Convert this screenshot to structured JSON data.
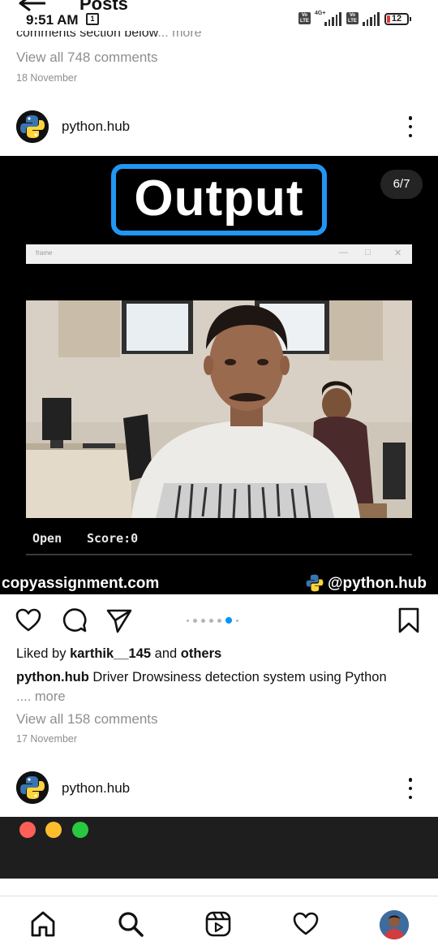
{
  "status_bar": {
    "time": "9:51 AM",
    "calendar_day": "1",
    "network_label": "4G+",
    "sim1": "Vo LTE",
    "sim2": "Vo LTE",
    "battery": "12"
  },
  "header": {
    "title": "Posts"
  },
  "previous_post": {
    "caption_tail": "comments section below",
    "more": "... more",
    "view_comments": "View all 748 comments",
    "date": "18 November"
  },
  "post": {
    "username": "python.hub",
    "media": {
      "heading": "Output",
      "counter": "6/7",
      "window_title": "frame",
      "status_open": "Open",
      "status_score": "Score:0",
      "watermark_left": "copyassignment.com",
      "watermark_right": "@python.hub"
    },
    "carousel": {
      "total": 7,
      "current": 6
    },
    "likes": {
      "prefix": "Liked by",
      "user": "karthik__145",
      "joiner": "and",
      "others": "others"
    },
    "caption": {
      "author": "python.hub",
      "text": "Driver Drowsiness detection system using Python",
      "more": ".... more"
    },
    "view_comments": "View all 158 comments",
    "date": "17 November"
  },
  "next_post": {
    "username": "python.hub",
    "window_buttons": {
      "close": "#ff5f57",
      "minimize": "#ffbd2e",
      "maximize": "#28c840"
    }
  },
  "bottom_nav": {
    "items": [
      "home-icon",
      "search-icon",
      "reels-icon",
      "activity-heart-icon",
      "profile-avatar"
    ]
  },
  "colors": {
    "accent_blue": "#0095f6",
    "output_border": "#2196f3",
    "secondary_text": "#8e8e8e"
  }
}
